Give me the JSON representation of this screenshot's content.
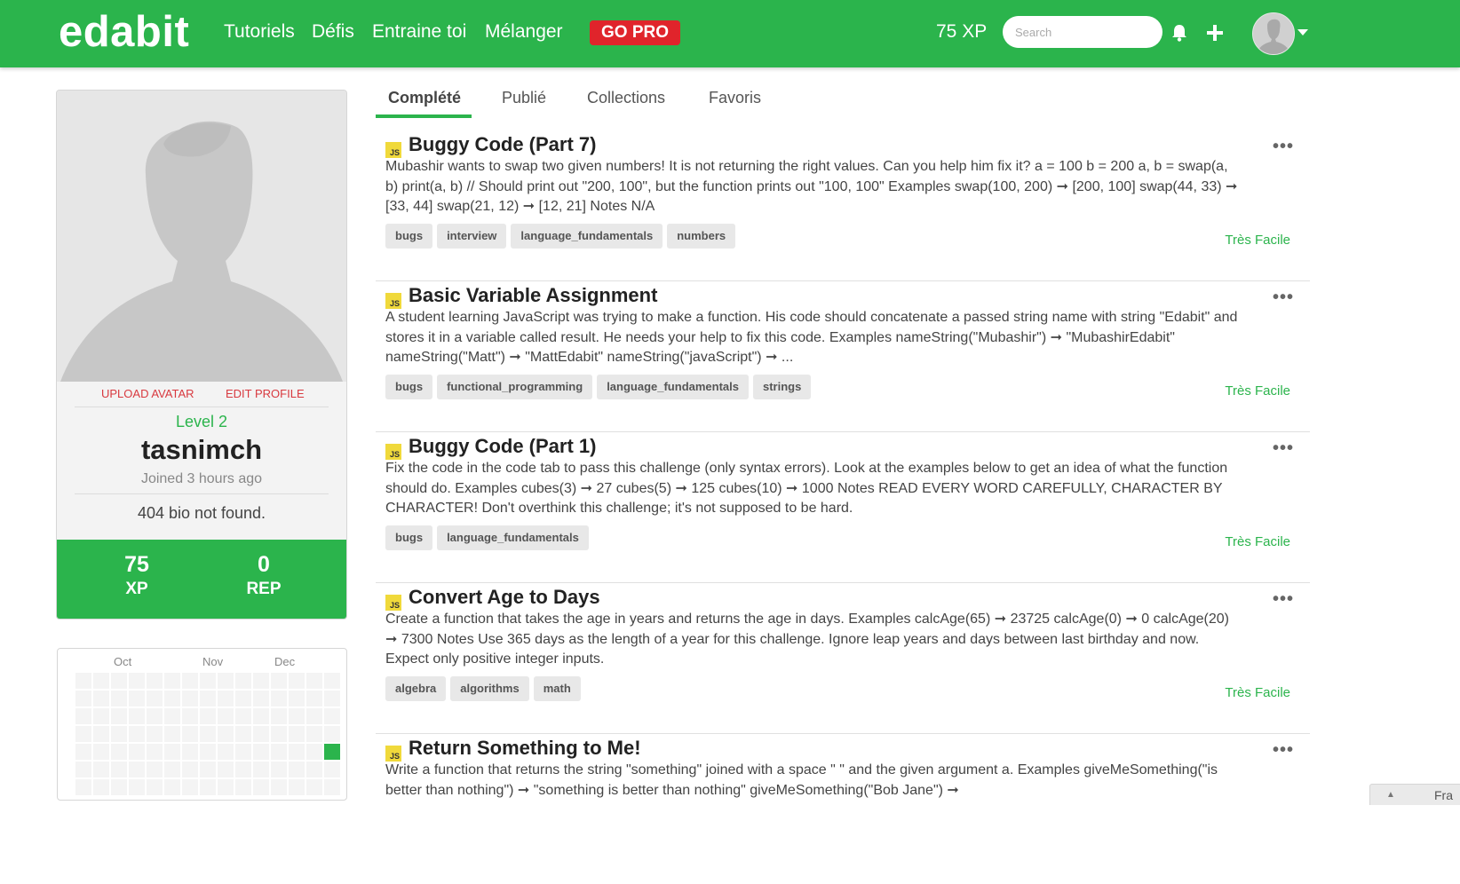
{
  "nav": {
    "logo": "edabit",
    "links": [
      "Tutoriels",
      "Défis",
      "Entraine toi",
      "Mélanger"
    ],
    "go_pro": "GO PRO",
    "xp": "75 XP",
    "search_placeholder": "Search"
  },
  "profile": {
    "upload_avatar": "UPLOAD AVATAR",
    "edit_profile": "EDIT PROFILE",
    "level": "Level 2",
    "username": "tasnimch",
    "joined": "Joined 3 hours ago",
    "bio": "404 bio not found.",
    "stats": [
      {
        "value": "75",
        "label": "XP"
      },
      {
        "value": "0",
        "label": "REP"
      }
    ]
  },
  "heatmap": {
    "months": [
      "Oct",
      "Nov",
      "Dec"
    ],
    "active_color": "#2bb44c"
  },
  "tabs": [
    "Complété",
    "Publié",
    "Collections",
    "Favoris"
  ],
  "challenges": [
    {
      "title": "Buggy Code (Part 7)",
      "description": "Mubashir wants to swap two given numbers! It is not returning the right values. Can you help him fix it? a = 100 b = 200 a, b = swap(a, b) print(a, b) // Should print out \"200, 100\", but the function prints out \"100, 100\" Examples swap(100, 200) ➞ [200, 100] swap(44, 33) ➞ [33, 44] swap(21, 12) ➞ [12, 21] Notes N/A",
      "tags": [
        "bugs",
        "interview",
        "language_fundamentals",
        "numbers"
      ],
      "difficulty": "Très Facile"
    },
    {
      "title": "Basic Variable Assignment",
      "description": "A student learning JavaScript was trying to make a function. His code should concatenate a passed string name with string \"Edabit\" and stores it in a variable called result. He needs your help to fix this code. Examples nameString(\"Mubashir\") ➞ \"MubashirEdabit\" nameString(\"Matt\") ➞ \"MattEdabit\" nameString(\"javaScript\") ➞ ...",
      "tags": [
        "bugs",
        "functional_programming",
        "language_fundamentals",
        "strings"
      ],
      "difficulty": "Très Facile"
    },
    {
      "title": "Buggy Code (Part 1)",
      "description": "Fix the code in the code tab to pass this challenge (only syntax errors). Look at the examples below to get an idea of what the function should do. Examples cubes(3) ➞ 27 cubes(5) ➞ 125 cubes(10) ➞ 1000 Notes READ EVERY WORD CAREFULLY, CHARACTER BY CHARACTER! Don't overthink this challenge; it's not supposed to be hard.",
      "tags": [
        "bugs",
        "language_fundamentals"
      ],
      "difficulty": "Très Facile"
    },
    {
      "title": "Convert Age to Days",
      "description": "Create a function that takes the age in years and returns the age in days. Examples calcAge(65) ➞ 23725 calcAge(0) ➞ 0 calcAge(20) ➞ 7300 Notes Use 365 days as the length of a year for this challenge. Ignore leap years and days between last birthday and now. Expect only positive integer inputs.",
      "tags": [
        "algebra",
        "algorithms",
        "math"
      ],
      "difficulty": "Très Facile"
    },
    {
      "title": "Return Something to Me!",
      "description": "Write a function that returns the string \"something\" joined with a space \" \" and the given argument a. Examples giveMeSomething(\"is better than nothing\") ➞ \"something is better than nothing\" giveMeSomething(\"Bob Jane\") ➞",
      "tags": [],
      "difficulty": ""
    }
  ],
  "js_badge": "JS",
  "more_icon": "•••",
  "language_button": "Fra"
}
